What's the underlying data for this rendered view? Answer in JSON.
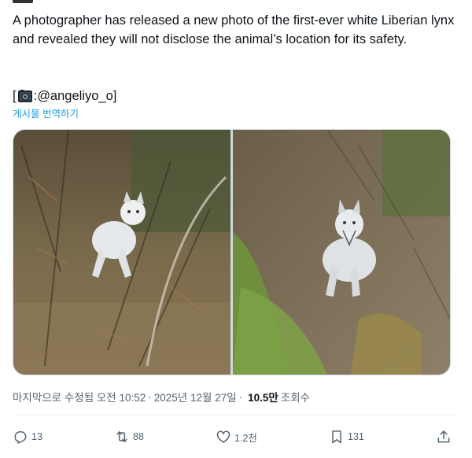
{
  "tweet": {
    "text": "A photographer has released a new photo of the first-ever white Liberian lynx and revealed they will not disclose the animal’s location for its safety.",
    "credit_prefix": "[",
    "credit_colon": ": ",
    "credit_handle": "@angeliyo_o",
    "credit_suffix": " ]",
    "translate_link": "게시물 번역하기"
  },
  "meta": {
    "edited_time": "마지막으로 수정됨 오전 10:52",
    "separator": "·",
    "date": "2025년 12월 27일",
    "views_count": "10.5만",
    "views_label": "조회수"
  },
  "actions": {
    "replies": "13",
    "reposts": "88",
    "likes": "1.2천",
    "bookmarks": "131"
  },
  "icons": {
    "credit": "camera-icon",
    "reply": "reply-icon",
    "repost": "repost-icon",
    "like": "heart-icon",
    "bookmark": "bookmark-icon",
    "share": "share-icon"
  },
  "colors": {
    "text": "#0f1419",
    "secondary": "#536471",
    "link": "#1d9bf0"
  }
}
